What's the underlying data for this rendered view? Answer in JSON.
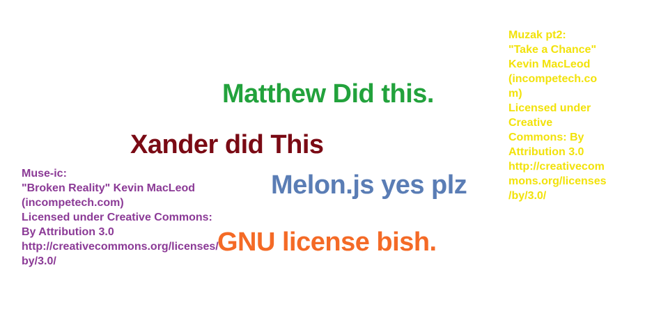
{
  "credits_left": {
    "text": "Muse-ic:\n\"Broken Reality\" Kevin MacLeod\n(incompetech.com)\nLicensed under Creative Commons:\nBy Attribution 3.0\nhttp://creativecommons.org/licenses/\nby/3.0/",
    "color": "#8b3a96"
  },
  "credits_right": {
    "text": "Muzak pt2:\n\"Take a Chance\"\nKevin MacLeod\n(incompetech.co\nm)\nLicensed under\nCreative\nCommons: By\nAttribution 3.0\nhttp://creativecom\nmons.org/licenses\n/by/3.0/",
    "color": "#f2e20a"
  },
  "headlines": {
    "matthew": {
      "text": "Matthew Did this.",
      "color": "#22a23c"
    },
    "xander": {
      "text": "Xander did This",
      "color": "#7a0a14"
    },
    "melon": {
      "text": "Melon.js yes plz",
      "color": "#5a7db5"
    },
    "gnu": {
      "text": "GNU license bish.",
      "color": "#f46a26"
    }
  }
}
